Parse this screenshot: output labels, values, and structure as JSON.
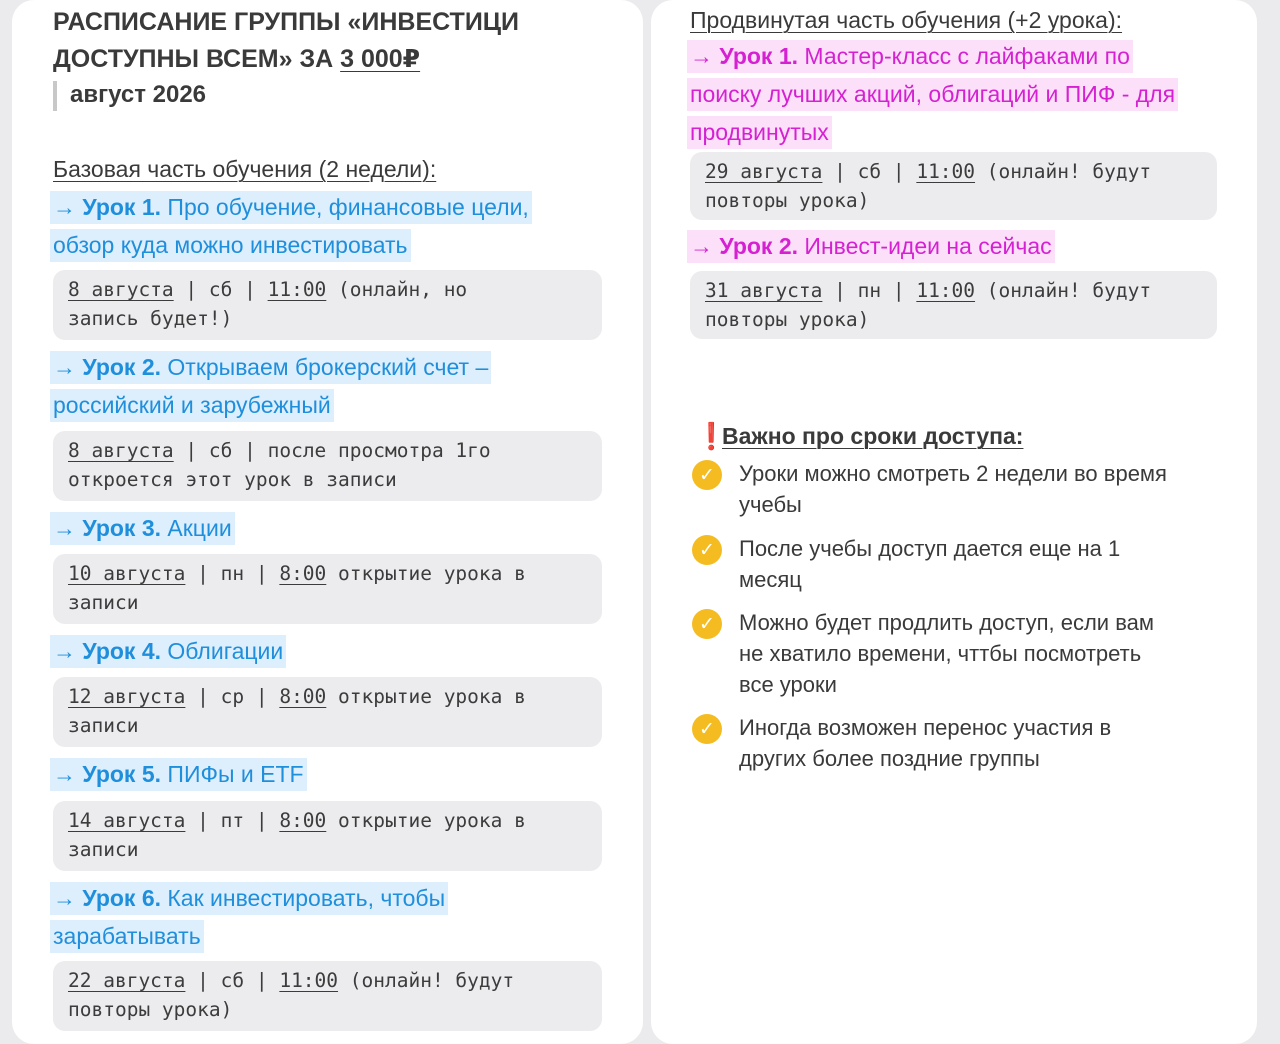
{
  "left": {
    "title_line1": "РАСПИСАНИЕ ГРУППЫ «ИНВЕСТИЦИ",
    "title_line2_prefix": "ДОСТУПНЫ ВСЕМ» ЗА ",
    "title_price": "3 000₽",
    "month": "август 2026",
    "section": "Базовая часть обучения (2 недели):",
    "lessons": [
      {
        "arrow": "→ ",
        "label": "Урок 1.",
        "lines": [
          "Про обучение, финансовые цели,",
          "обзор куда можно инвестировать"
        ],
        "note": {
          "date": "8 августа",
          "mid1": " | сб | ",
          "time": "11:00",
          "tail": " (онлайн, но",
          "line2": "запись будет!)"
        }
      },
      {
        "arrow": "→ ",
        "label": "Урок 2.",
        "lines": [
          "Открываем брокерский счет –",
          "российский и зарубежный"
        ],
        "note": {
          "date": "8 августа",
          "mid1": " | сб | ",
          "time": "",
          "tail": "после просмотра 1го",
          "line2": "откроется этот урок в записи"
        }
      },
      {
        "arrow": "→ ",
        "label": "Урок 3.",
        "lines": [
          "Акции"
        ],
        "note": {
          "date": "10 августа",
          "mid1": " | пн | ",
          "time": "8:00",
          "tail": " открытие урока в",
          "line2": "записи"
        }
      },
      {
        "arrow": "→ ",
        "label": "Урок 4.",
        "lines": [
          "Облигации"
        ],
        "note": {
          "date": "12 августа",
          "mid1": " | ср | ",
          "time": "8:00",
          "tail": " открытие урока в",
          "line2": "записи"
        }
      },
      {
        "arrow": "→ ",
        "label": "Урок 5.",
        "lines": [
          "ПИФы и ETF"
        ],
        "note": {
          "date": "14 августа",
          "mid1": " | пт | ",
          "time": "8:00",
          "tail": " открытие урока в",
          "line2": "записи"
        }
      },
      {
        "arrow": "→ ",
        "label": "Урок 6.",
        "lines": [
          "Как инвестировать, чтобы",
          "зарабатывать"
        ],
        "note": {
          "date": "22 августа",
          "mid1": " | сб | ",
          "time": "11:00",
          "tail": " (онлайн! будут",
          "line2": "повторы урока)"
        }
      }
    ]
  },
  "right": {
    "section": "Продвинутая часть обучения (+2 урока):",
    "lessons": [
      {
        "arrow": "→ ",
        "label": "Урок 1.",
        "lines": [
          "Мастер-класс с лайфаками по",
          "поиску лучших акций, облигаций и ПИФ - для",
          "продвинутых"
        ],
        "note": {
          "date": "29 августа",
          "mid1": " | сб | ",
          "time": "11:00",
          "tail": " (онлайн! будут",
          "line2": "повторы урока)"
        }
      },
      {
        "arrow": "→ ",
        "label": "Урок 2.",
        "lines": [
          "Инвест-идеи на сейчас"
        ],
        "note": {
          "date": "31 августа",
          "mid1": " | пн | ",
          "time": "11:00",
          "tail": " (онлайн! будут",
          "line2": "повторы урока)"
        }
      }
    ],
    "important": {
      "mark": "❗",
      "title": "Важно про сроки доступа:",
      "check_icon": "✓",
      "items": [
        {
          "lines": [
            "Уроки можно смотреть 2 недели во время",
            "учебы"
          ]
        },
        {
          "lines": [
            "После учебы доступ дается еще на 1",
            "месяц"
          ]
        },
        {
          "lines": [
            "Можно будет продлить доступ, если вам",
            "не хватило времени, чттбы посмотреть",
            "все уроки"
          ]
        },
        {
          "lines": [
            "Иногда возможен перенос участия в",
            "других более поздние группы"
          ]
        }
      ]
    }
  },
  "colors": {
    "blue_text": "#1f8fdc",
    "blue_highlight": "#ddeefd",
    "pink_text": "#d521d2",
    "pink_highlight": "#fce0fa",
    "check": "#f5bc22",
    "warn": "#e22a2a"
  }
}
